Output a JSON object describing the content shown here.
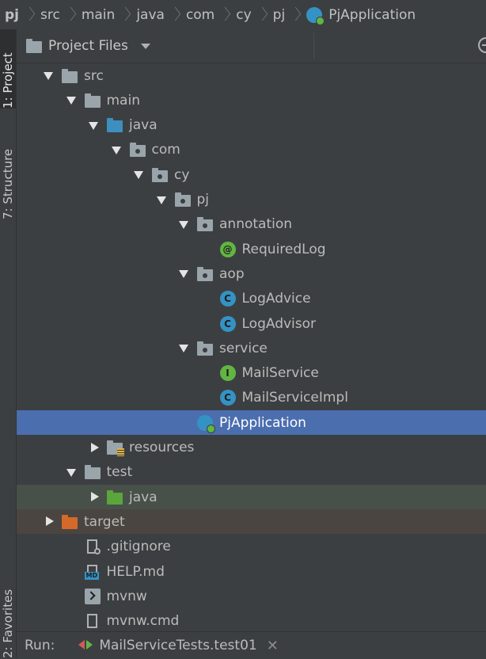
{
  "breadcrumb": {
    "items": [
      "pj",
      "src",
      "main",
      "java",
      "com",
      "cy",
      "pj",
      "PjApplication"
    ]
  },
  "left_strip": {
    "tabs": [
      "1: Project",
      "7: Structure",
      "2: Favorites"
    ]
  },
  "panel": {
    "title": "Project Files"
  },
  "tree": [
    {
      "label": "src",
      "icon": "folder-icon",
      "depth": 0,
      "expand": "down"
    },
    {
      "label": "main",
      "icon": "folder-icon",
      "depth": 1,
      "expand": "down"
    },
    {
      "label": "java",
      "icon": "source-folder-icon",
      "depth": 2,
      "expand": "down"
    },
    {
      "label": "com",
      "icon": "package-icon",
      "depth": 3,
      "expand": "down"
    },
    {
      "label": "cy",
      "icon": "package-icon",
      "depth": 4,
      "expand": "down"
    },
    {
      "label": "pj",
      "icon": "package-icon",
      "depth": 5,
      "expand": "down"
    },
    {
      "label": "annotation",
      "icon": "package-icon",
      "depth": 6,
      "expand": "down"
    },
    {
      "label": "RequiredLog",
      "icon": "annotation-icon",
      "depth": 7,
      "expand": "none"
    },
    {
      "label": "aop",
      "icon": "package-icon",
      "depth": 6,
      "expand": "down"
    },
    {
      "label": "LogAdvice",
      "icon": "class-icon",
      "depth": 7,
      "expand": "none"
    },
    {
      "label": "LogAdvisor",
      "icon": "class-icon",
      "depth": 7,
      "expand": "none"
    },
    {
      "label": "service",
      "icon": "package-icon",
      "depth": 6,
      "expand": "down"
    },
    {
      "label": "MailService",
      "icon": "interface-icon",
      "depth": 7,
      "expand": "none"
    },
    {
      "label": "MailServiceImpl",
      "icon": "class-icon",
      "depth": 7,
      "expand": "none"
    },
    {
      "label": "PjApplication",
      "icon": "spring-app-icon",
      "depth": 6,
      "expand": "none",
      "selected": true
    },
    {
      "label": "resources",
      "icon": "resources-folder-icon",
      "depth": 2,
      "expand": "right"
    },
    {
      "label": "test",
      "icon": "folder-icon",
      "depth": 1,
      "expand": "down"
    },
    {
      "label": "java",
      "icon": "test-folder-icon",
      "depth": 2,
      "expand": "right",
      "highlight": "test"
    },
    {
      "label": "target",
      "icon": "excluded-folder-icon",
      "depth": 0,
      "expand": "right",
      "highlight": "excluded"
    },
    {
      "label": ".gitignore",
      "icon": "gitignore-icon",
      "depth": 1,
      "expand": "none"
    },
    {
      "label": "HELP.md",
      "icon": "markdown-icon",
      "depth": 1,
      "expand": "none"
    },
    {
      "label": "mvnw",
      "icon": "terminal-icon",
      "depth": 1,
      "expand": "none"
    },
    {
      "label": "mvnw.cmd",
      "icon": "file-icon",
      "depth": 1,
      "expand": "none"
    }
  ],
  "run_bar": {
    "label": "Run:",
    "config_name": "MailServiceTests.test01"
  }
}
